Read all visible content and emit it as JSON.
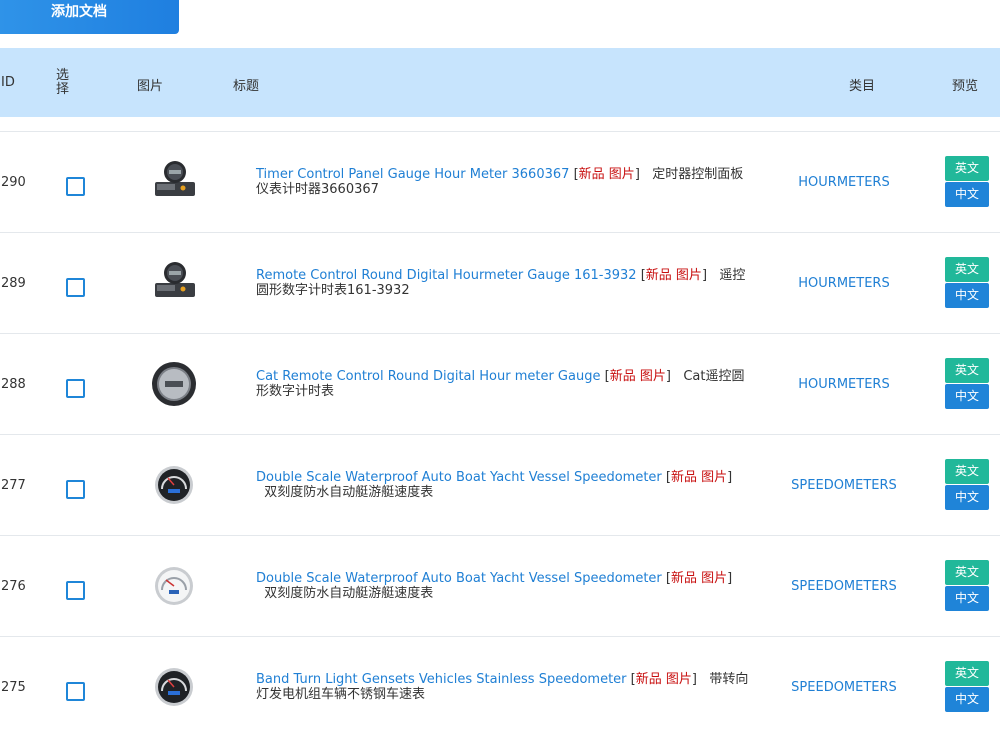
{
  "toolbar": {
    "add_label": "添加文档"
  },
  "header": {
    "id": "ID",
    "select": "选择",
    "image": "图片",
    "title": "标题",
    "category": "类目",
    "preview": "预览"
  },
  "rows": [
    {
      "id": "290",
      "title_en": "Timer Control Panel Gauge Hour Meter 3660367",
      "tag_new": "新品",
      "tag_img": "图片",
      "title_zh": "定时器控制面板仪表计时器3660367",
      "category": "HOURMETERS",
      "icon": "hourmeter-panel",
      "btn_en": "英文",
      "btn_zh": "中文"
    },
    {
      "id": "289",
      "title_en": "Remote Control Round Digital Hourmeter Gauge 161-3932",
      "tag_new": "新品",
      "tag_img": "图片",
      "title_zh": "遥控圆形数字计时表161-3932",
      "category": "HOURMETERS",
      "icon": "hourmeter-panel",
      "btn_en": "英文",
      "btn_zh": "中文"
    },
    {
      "id": "288",
      "title_en": "Cat Remote Control Round Digital Hour meter Gauge",
      "tag_new": "新品",
      "tag_img": "图片",
      "title_zh": "Cat遥控圆形数字计时表",
      "category": "HOURMETERS",
      "icon": "round-digital-gauge",
      "btn_en": "英文",
      "btn_zh": "中文"
    },
    {
      "id": "277",
      "title_en": "Double Scale Waterproof Auto Boat Yacht Vessel Speedometer",
      "tag_new": "新品",
      "tag_img": "图片",
      "title_zh": "双刻度防水自动艇游艇速度表",
      "category": "SPEEDOMETERS",
      "icon": "speedometer-dark",
      "btn_en": "英文",
      "btn_zh": "中文"
    },
    {
      "id": "276",
      "title_en": "Double Scale Waterproof Auto Boat Yacht Vessel Speedometer",
      "tag_new": "新品",
      "tag_img": "图片",
      "title_zh": "双刻度防水自动艇游艇速度表",
      "category": "SPEEDOMETERS",
      "icon": "speedometer-white",
      "btn_en": "英文",
      "btn_zh": "中文"
    },
    {
      "id": "275",
      "title_en": "Band Turn Light Gensets Vehicles Stainless Speedometer",
      "tag_new": "新品",
      "tag_img": "图片",
      "title_zh": "带转向灯发电机组车辆不锈钢车速表",
      "category": "SPEEDOMETERS",
      "icon": "speedometer-dark",
      "btn_en": "英文",
      "btn_zh": "中文"
    }
  ],
  "colors": {
    "accent": "#1f84d8",
    "header_bg": "#c7e4fd",
    "tag": "#c81010",
    "preview_en": "#21b89a"
  }
}
